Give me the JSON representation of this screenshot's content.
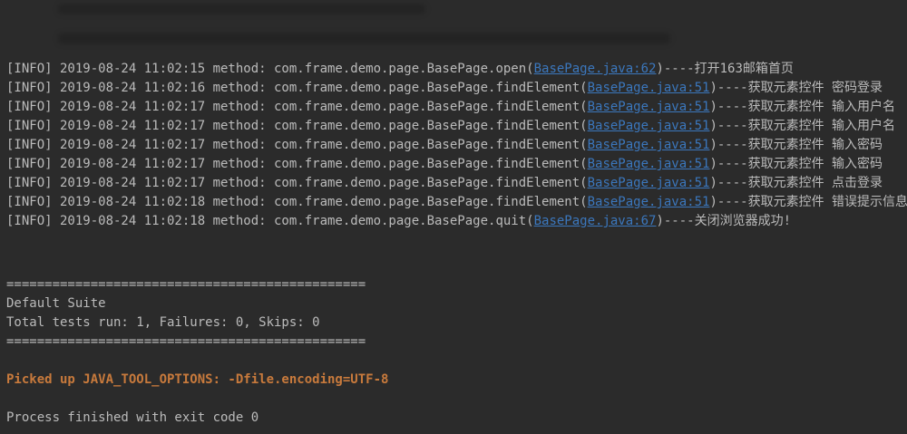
{
  "colors": {
    "background": "#2b2b2b",
    "text": "#bbbbbb",
    "link": "#3b77bd",
    "stderr_orange": "#c87a3c"
  },
  "console": {
    "log_lines": [
      {
        "prefix": "[INFO] 2019-08-24 11:02:15 method: com.frame.demo.page.BasePage.open(",
        "link": "BasePage.java:62",
        "suffix": ")----打开163邮箱首页"
      },
      {
        "prefix": "[INFO] 2019-08-24 11:02:16 method: com.frame.demo.page.BasePage.findElement(",
        "link": "BasePage.java:51",
        "suffix": ")----获取元素控件 密码登录"
      },
      {
        "prefix": "[INFO] 2019-08-24 11:02:17 method: com.frame.demo.page.BasePage.findElement(",
        "link": "BasePage.java:51",
        "suffix": ")----获取元素控件 输入用户名"
      },
      {
        "prefix": "[INFO] 2019-08-24 11:02:17 method: com.frame.demo.page.BasePage.findElement(",
        "link": "BasePage.java:51",
        "suffix": ")----获取元素控件 输入用户名"
      },
      {
        "prefix": "[INFO] 2019-08-24 11:02:17 method: com.frame.demo.page.BasePage.findElement(",
        "link": "BasePage.java:51",
        "suffix": ")----获取元素控件 输入密码"
      },
      {
        "prefix": "[INFO] 2019-08-24 11:02:17 method: com.frame.demo.page.BasePage.findElement(",
        "link": "BasePage.java:51",
        "suffix": ")----获取元素控件 输入密码"
      },
      {
        "prefix": "[INFO] 2019-08-24 11:02:17 method: com.frame.demo.page.BasePage.findElement(",
        "link": "BasePage.java:51",
        "suffix": ")----获取元素控件 点击登录"
      },
      {
        "prefix": "[INFO] 2019-08-24 11:02:18 method: com.frame.demo.page.BasePage.findElement(",
        "link": "BasePage.java:51",
        "suffix": ")----获取元素控件 错误提示信息"
      },
      {
        "prefix": "[INFO] 2019-08-24 11:02:18 method: com.frame.demo.page.BasePage.quit(",
        "link": "BasePage.java:67",
        "suffix": ")----关闭浏览器成功!"
      }
    ],
    "summary": {
      "separator_top": "===============================================",
      "suite_name": "Default Suite",
      "totals": "Total tests run: 1, Failures: 0, Skips: 0",
      "separator_bottom": "==============================================="
    },
    "stderr_line": "Picked up JAVA_TOOL_OPTIONS: -Dfile.encoding=UTF-8",
    "exit_line": "Process finished with exit code 0"
  }
}
